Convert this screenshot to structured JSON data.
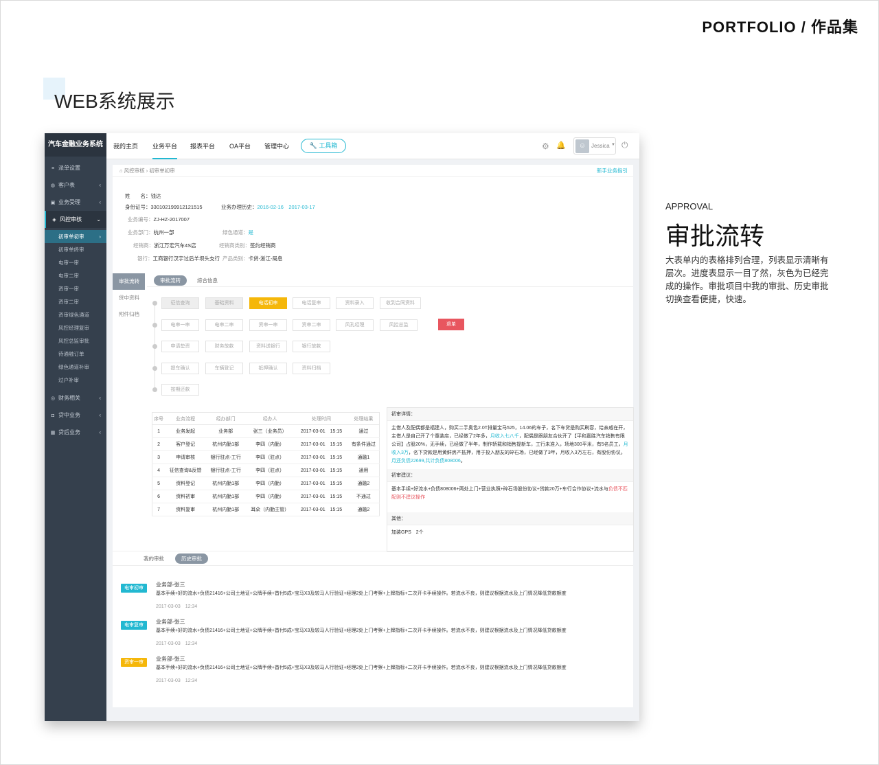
{
  "portfolio": "PORTFOLIO / 作品集",
  "section_title": "WEB系统展示",
  "app": {
    "brand": "汽车金融业务系统",
    "sidebar": {
      "items": [
        {
          "label": "派单设置",
          "icon": "list-icon"
        },
        {
          "label": "客户表",
          "icon": "user-icon",
          "arrow": "‹"
        },
        {
          "label": "业务受理",
          "icon": "folder-icon",
          "arrow": "‹"
        },
        {
          "label": "风控审核",
          "icon": "shield-icon",
          "arrow": "⌄"
        }
      ],
      "subitems": [
        "初审单初审",
        "初审单终审",
        "电审一审",
        "电审二审",
        "资审一审",
        "资审二审",
        "资审绿色通道",
        "风控经理复审",
        "风控总监审批",
        "待通融订单",
        "绿色通道补审",
        "过户补审"
      ],
      "bottom": [
        {
          "label": "财务相关",
          "icon": "money-icon",
          "arrow": "‹"
        },
        {
          "label": "贷中业务",
          "icon": "doc-icon",
          "arrow": "‹"
        },
        {
          "label": "贷后业务",
          "icon": "grid-icon",
          "arrow": "‹"
        }
      ]
    },
    "topnav": [
      "我的主页",
      "业务平台",
      "报表平台",
      "OA平台",
      "管理中心"
    ],
    "toolbox": "工具箱",
    "user": "Jessica",
    "breadcrumb": {
      "root": "风控审核",
      "current": "初审单初审",
      "guide": "新手业务指引"
    },
    "customer": {
      "name_label": "姓　　名：",
      "name": "钱达",
      "id_label": "身份证号：",
      "id": "330102199912121515",
      "history_label": "业务办理历史：",
      "history": [
        "2016-02-16",
        "2017-03-17"
      ],
      "bizno_label": "业务编号：",
      "bizno": "ZJ-HZ-2017007",
      "dept_label": "业务部门：",
      "dept": "杭州一部",
      "green_label": "绿色通道：",
      "green": "是",
      "dealer_label": "经销商：",
      "dealer": "浙江万宏汽车4S店",
      "dealer_type_label": "经销商类别：",
      "dealer_type": "签约经销商",
      "bank_label": "银行：",
      "bank": "工商银行汉宇过后羊坝头支行",
      "product_label": "产品类别：",
      "product": "卡贷-浙江-局息"
    },
    "left_tabs": [
      "审批流转",
      "贷中资料",
      "附件归档"
    ],
    "right_tabs": [
      "审批流转",
      "综合信息"
    ],
    "flow_rows": [
      [
        "征信查询",
        "基础资料",
        "电话初审",
        "电话复审",
        "资料录入",
        "收到合同资料"
      ],
      [
        "电审一审",
        "电审二审",
        "资审一审",
        "资审二审",
        "风孔经理",
        "风控总监"
      ],
      [
        "申请垫资",
        "财务放款",
        "资料送银行",
        "银行放款"
      ],
      [
        "提车确认",
        "车辆登记",
        "抵押确认",
        "资料归档"
      ],
      [
        "按期还款"
      ]
    ],
    "return_btn": "退单",
    "table": {
      "headers": [
        "序号",
        "业务流程",
        "经办部门",
        "经办人",
        "处理时间",
        "处理结果"
      ],
      "rows": [
        [
          "1",
          "业务发起",
          "业务部",
          "张三（业务员）",
          "2017-03-01　15:15",
          "通过"
        ],
        [
          "2",
          "客户登记",
          "杭州内勤1部",
          "李四（内勤）",
          "2017-03-01　15:15",
          "有条件通过"
        ],
        [
          "3",
          "申请审核",
          "银行驻点-工行",
          "李四（驻点）",
          "2017-03-01　15:15",
          "通融1"
        ],
        [
          "4",
          "征信查询&反馈",
          "银行驻点-工行",
          "李四（驻点）",
          "2017-03-01　15:15",
          "通用"
        ],
        [
          "5",
          "资料登记",
          "杭州内勤1部",
          "李四（内勤）",
          "2017-03-01　15:15",
          "通融2"
        ],
        [
          "6",
          "资料初审",
          "杭州内勤1部",
          "李四（内勤）",
          "2017-03-01　15:15",
          "不通过"
        ],
        [
          "7",
          "资料复审",
          "杭州内勤1部",
          "耳朵（内勤主管）",
          "2017-03-01　15:15",
          "通融2"
        ]
      ]
    },
    "detail": {
      "h1": "初审详情：",
      "p1a": "主借人及配偶都是福建人，购买二手奥色2.0T排量宝马525，14.06的车子，名下车贷是购买刷容，给亲戚在开，主借人是自己开了个童装店，已经做了2年多，",
      "p1b": "月收入七八千",
      "p1c": "，配偶是跟朋友合伙开了【平和嘉胜汽车销售有限公司】占股20%，无手续，已经做了半年，制作轿载和销售提新车，工行未准入，场地300平米，有5名员工，",
      "p1d": "月收入3万",
      "p1e": "，名下贷款是用黄鲜房产抵押，用于投入朋友的碎石场，已经做了3年，月收入3万左右，有股份协议。",
      "p1f": "月还负债22699,共计负债808006",
      "p1g": "。",
      "h2": "初审建议：",
      "p2a": "基本手续+好流水+负债808006+两处上门+营业执照+碎石场股份协议+贷款20万+车行合作协议+流水与",
      "p2b": "负债不匹配则不建议操作",
      "h3": "其他：",
      "p3": "加装GPS　2个"
    },
    "history_tabs": [
      "我的审批",
      "历史审批"
    ],
    "history": [
      {
        "tag": "电审初审",
        "color": "#22b8d1",
        "name": "业务部-张三",
        "body": "基本手续+好的流水+负债21416+公司土地证+公牌手续+首付5成+宝马X3及较马人行验证+经理2处上门考察+上牌指标+二次开卡手续操作。若流水不良，则建议根据流水及上门情况降低贷款额度",
        "time": "2017-03-03　12:34"
      },
      {
        "tag": "电审复审",
        "color": "#22b8d1",
        "name": "业务部-张三",
        "body": "基本手续+好的流水+负债21416+公司土地证+公牌手续+首付5成+宝马X3及较马人行验证+经理2处上门考察+上牌指标+二次开卡手续操作。若流水不良，则建议根据流水及上门情况降低贷款额度",
        "time": "2017-03-03　12:34"
      },
      {
        "tag": "资审一审",
        "color": "#f5b70a",
        "name": "业务部-张三",
        "body": "基本手续+好的流水+负债21416+公司土地证+公牌手续+首付5成+宝马X3及较马人行验证+经理2处上门考察+上牌指标+二次开卡手续操作。若流水不良，则建议根据流水及上门情况降低贷款额度",
        "time": "2017-03-03　12:34"
      }
    ]
  },
  "approval": {
    "en": "APPROVAL",
    "cn": "审批流转",
    "desc": "大表单内的表格排列合理，列表显示清晰有层次。进度表显示一目了然，灰色为已经完成的操作。审批项目中我的审批、历史审批切换查看便捷，快速。"
  },
  "colors": {
    "accent": "#22b8d1",
    "sidebar": "#35404d",
    "current": "#f5b70a",
    "danger": "#e8565f"
  }
}
